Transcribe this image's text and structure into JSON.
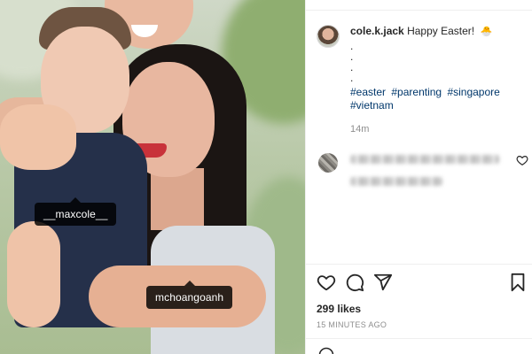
{
  "post": {
    "tags": [
      {
        "label": "__maxcole__"
      },
      {
        "label": "mchoangoanh"
      }
    ]
  },
  "caption": {
    "username": "cole.k.jack",
    "text": "Happy Easter!",
    "emoji": "🐣",
    "dots": [
      ".",
      ".",
      ".",
      "."
    ],
    "hashtags": [
      "#easter",
      "#parenting",
      "#singapore",
      "#vietnam"
    ],
    "time": "14m"
  },
  "comment": {
    "blurred": true
  },
  "actions": {
    "icons": [
      "heart-icon",
      "comment-icon",
      "share-icon",
      "bookmark-icon"
    ]
  },
  "stats": {
    "likes": "299 likes",
    "posted": "15 MINUTES AGO"
  },
  "colors": {
    "text": "#262626",
    "hashtag": "#00376b",
    "muted": "#8e8e8e",
    "tag_bg": "#000000",
    "lips": "#c8323a"
  }
}
